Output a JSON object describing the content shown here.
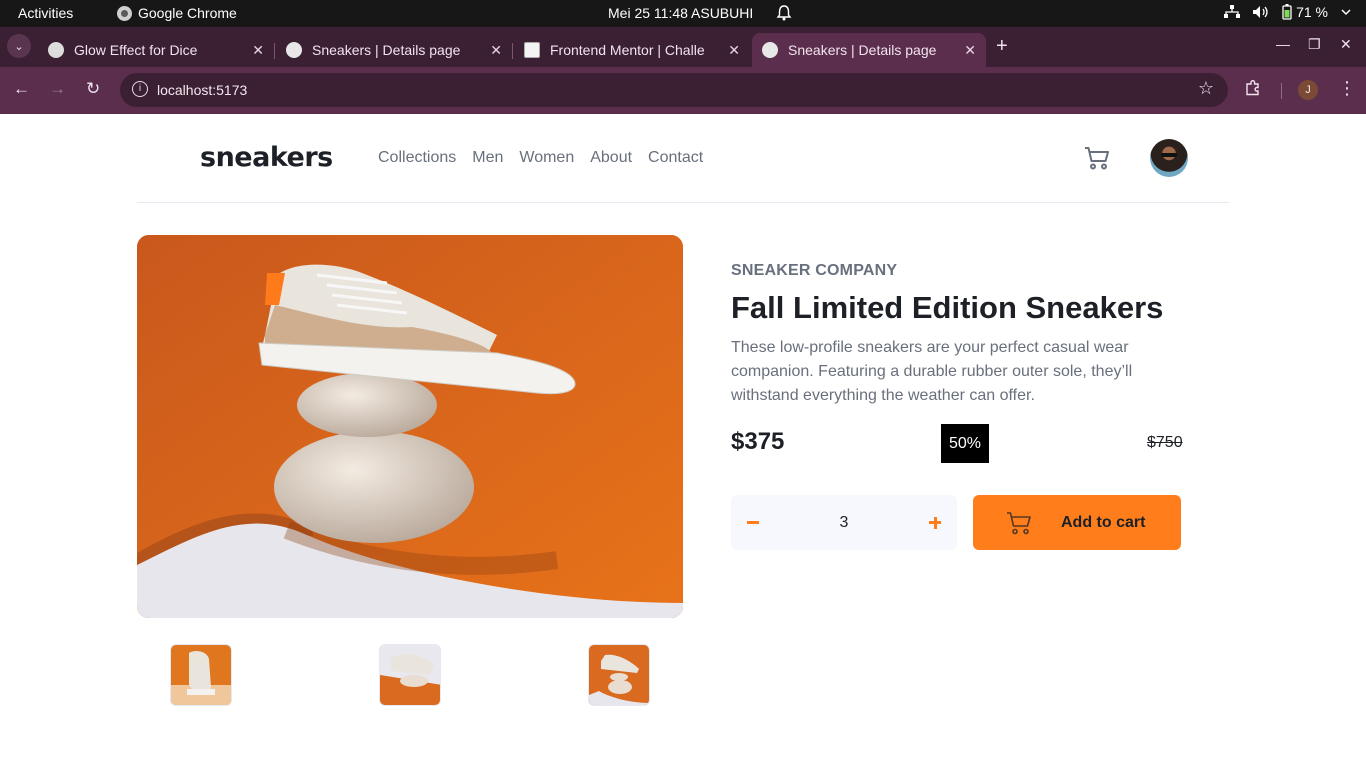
{
  "system_bar": {
    "activities": "Activities",
    "app_name": "Google Chrome",
    "clock": "Mei 25  11:48 ASUBUHI",
    "battery": "71 %"
  },
  "browser": {
    "tabs": [
      {
        "title": "Glow Effect for Dice",
        "active": false
      },
      {
        "title": "Sneakers | Details page",
        "active": false
      },
      {
        "title": "Frontend Mentor | Challe",
        "active": false
      },
      {
        "title": "Sneakers | Details page",
        "active": true
      }
    ],
    "url": "localhost:5173",
    "profile_initial": "J"
  },
  "site": {
    "logo": "sneakers",
    "nav": [
      "Collections",
      "Men",
      "Women",
      "About",
      "Contact"
    ]
  },
  "product": {
    "company": "SNEAKER COMPANY",
    "title": "Fall Limited Edition Sneakers",
    "description": "These low-profile sneakers are your perfect casual wear companion. Featuring a durable rubber outer sole, they’ll withstand everything the weather can offer.",
    "price": "$375",
    "discount": "50%",
    "original_price": "$750",
    "quantity": "3",
    "add_to_cart": "Add to cart"
  },
  "colors": {
    "accent": "#ff7e1b",
    "hero_bg": "#d96a20",
    "text_dark": "#1d2026",
    "text_muted": "#69707d"
  }
}
